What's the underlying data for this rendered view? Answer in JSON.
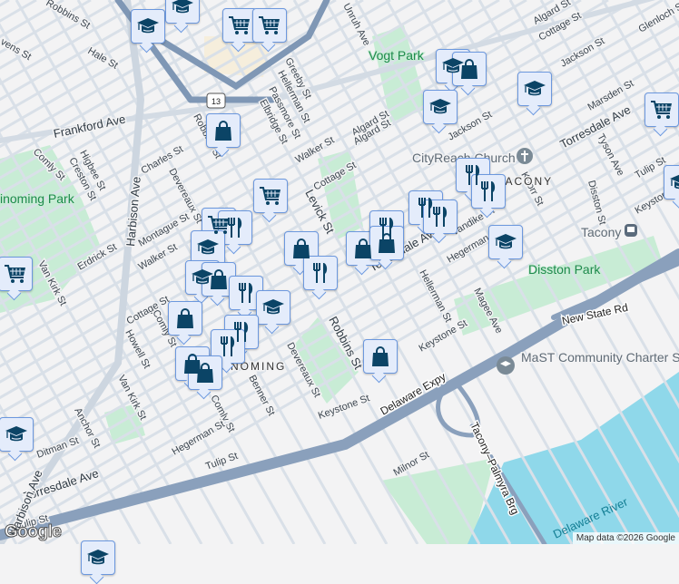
{
  "labels": {
    "robbins_1": "Robbins St",
    "hale": "Hale St",
    "stevens": "vens St",
    "frankford": "Frankford Ave",
    "robbins_2": "Robbins St",
    "greeby": "Greeby St",
    "hellerman_1": "Hellerman St",
    "passmore": "Passmore St",
    "elbridge": "Elbridge St",
    "walker_1": "Walker St",
    "algard_1": "Algard St",
    "cottage_1": "Cottage St",
    "levick": "Levick St",
    "charles": "Charles St",
    "comly_1": "Comly St",
    "higbee": "Higbee St",
    "creston": "Creston St",
    "harbison_1": "Harbison Ave",
    "devereaux_1": "Devereaux St",
    "montague": "Montague St",
    "erdrick": "Erdrick St",
    "walker_2": "Walker St",
    "vankirk_1": "Van Kirk St",
    "unruh": "Unruh Ave",
    "jackson_1": "Jackson St",
    "algard_2": "Algard St",
    "torresdale_1": "Torresdale Ave",
    "marsden": "Marsden St",
    "jackson_2": "Jackson St",
    "cottage_2": "Cottage St",
    "algard_3": "Algard St",
    "glenloch": "Glenloch St",
    "tyson": "Tyson Ave",
    "disston": "Disston St",
    "tulip_1": "Tulip St",
    "keystone_1": "Keystone St",
    "knorr": "Knorr St",
    "vandike": "Vandike St",
    "hegerman_1": "Hegerman St",
    "torresdale_2": "Torresdale Ave",
    "hellerman_2": "Hellerman St",
    "magee": "Magee Ave",
    "keystone_2": "Keystone St",
    "robbins_3": "Robbins St",
    "milnor": "Milnor St",
    "keystone_3": "Keystone St",
    "cottage_3": "Cottage St",
    "comly_2": "Comly St",
    "howell": "Howell St",
    "vankirk_2": "Van Kirk St",
    "benner": "Benner St",
    "devereaux_2": "Devereaux St",
    "comly_3": "Comly St",
    "hegerman_2": "Hegerman St",
    "tulip_2": "Tulip St",
    "anchor": "Anchor St",
    "ditman": "Ditman St",
    "torresdale_3": "Torresdale Ave",
    "tulip_3": "Tulip St",
    "harbison_2": "Harbison Ave",
    "vankirk_3": "Van Kirk St"
  },
  "parks": {
    "wissinoming_park": "inoming Park",
    "vogt_park": "Vogt Park",
    "disston_park": "Disston Park"
  },
  "neighborhoods": {
    "tacony": "TACONY",
    "wissinoming": "WISSINOMING"
  },
  "pois": {
    "church": "CityReach Church",
    "school": "MaST Community Charter School II",
    "station": "Tacony"
  },
  "roads": {
    "route": "13",
    "new_state": "New State Rd",
    "expy": "Delaware Expy",
    "bridge": "Tacony–Palmyra Brg"
  },
  "water": {
    "river": "Delaware River"
  },
  "markers": [
    "school",
    "school",
    "cart",
    "cart",
    "school",
    "school",
    "bag",
    "school",
    "school",
    "cart",
    "bag",
    "cart",
    "cart",
    "food",
    "school",
    "school",
    "bag",
    "food",
    "school",
    "bag",
    "food",
    "food",
    "bag",
    "bag",
    "bag",
    "food",
    "bag",
    "food",
    "bag",
    "food",
    "food",
    "food",
    "food",
    "school",
    "bag",
    "cart",
    "school",
    "school"
  ],
  "footer": {
    "google": "Google",
    "attribution": "Map data ©2026 Google"
  },
  "colors": {
    "marker_bg": "#e4ecfb",
    "marker_border": "#6c98de",
    "icon": "#0b4466",
    "park": "#c8ecd5",
    "water": "#8fd8ea",
    "highway": "#8aa0bc"
  }
}
